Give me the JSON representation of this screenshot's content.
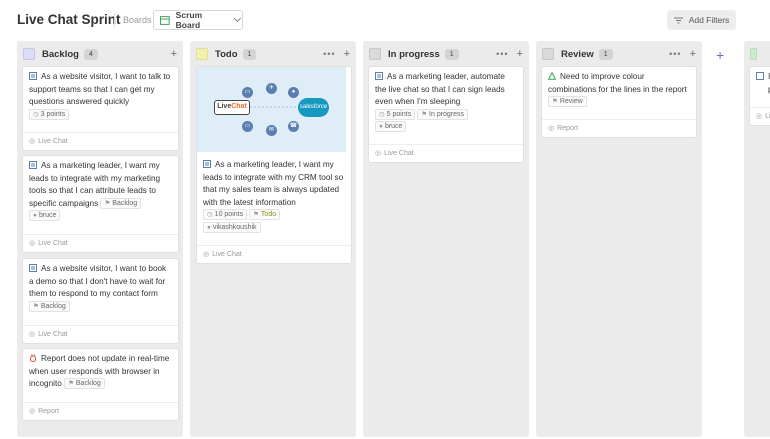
{
  "header": {
    "title": "Live Chat Sprint",
    "boards_label": "Boards",
    "board_select": "Scrum Board",
    "add_filters": "Add Filters"
  },
  "colors": {
    "story_icon": "#5b7fb0",
    "bug_icon": "#e0533f",
    "improvement_icon": "#3aa15a",
    "add_column": "#6b6bd6"
  },
  "columns": [
    {
      "title": "Backlog",
      "count": "4",
      "add_label": "+",
      "cards": [
        {
          "type": "story-icon",
          "text": "As a website visitor, I want to talk to support teams so that I can get my questions answered quickly",
          "chips": [
            "3 points"
          ],
          "footer": "Live Chat"
        },
        {
          "type": "story-icon",
          "text": "As a marketing leader, I want my leads to integrate with my marketing tools so that I can attribute leads to specific campaigns",
          "chips": [
            "Backlog",
            "bruce"
          ],
          "footer": "Live Chat"
        },
        {
          "type": "story-icon",
          "text": "As a website visitor, I want to book a demo so that I don't have to wait for them to respond to my contact form",
          "chips": [
            "Backlog"
          ],
          "footer": "Live Chat"
        },
        {
          "type": "bug-icon",
          "text": "Report does not update in real-time when user responds with browser in incognito",
          "chips": [
            "Backlog"
          ],
          "footer": "Report"
        }
      ]
    },
    {
      "title": "Todo",
      "count": "1",
      "more_label": "•••",
      "add_label": "+",
      "cards": [
        {
          "type": "story-icon",
          "image": {
            "left_logo": [
              "Live",
              "Chat"
            ],
            "right_logo": "salesforce"
          },
          "text": "As a marketing leader, I want my leads to integrate with my CRM tool so that my sales team is always updated with the latest information",
          "chips": [
            "10 points",
            "Todo",
            "vikashkoushik"
          ],
          "footer": "Live Chat"
        }
      ]
    },
    {
      "title": "In progress",
      "count": "1",
      "more_label": "•••",
      "add_label": "+",
      "cards": [
        {
          "type": "story-icon",
          "text": "As a marketing leader, automate the live chat so that I can sign leads even when I'm sleeping",
          "chips": [
            "5 points",
            "In progress",
            "bruce"
          ],
          "footer": "Live Chat"
        }
      ]
    },
    {
      "title": "Review",
      "count": "1",
      "more_label": "•••",
      "add_label": "+",
      "cards": [
        {
          "type": "improvement-icon",
          "text": "Need to improve colour combinations for the lines in the report",
          "chips": [
            "Review"
          ],
          "footer": "Report"
        }
      ]
    }
  ],
  "add_column_label": "+",
  "partial_column": {
    "card_text": "I",
    "card_text2": "p",
    "footer": "Li"
  }
}
